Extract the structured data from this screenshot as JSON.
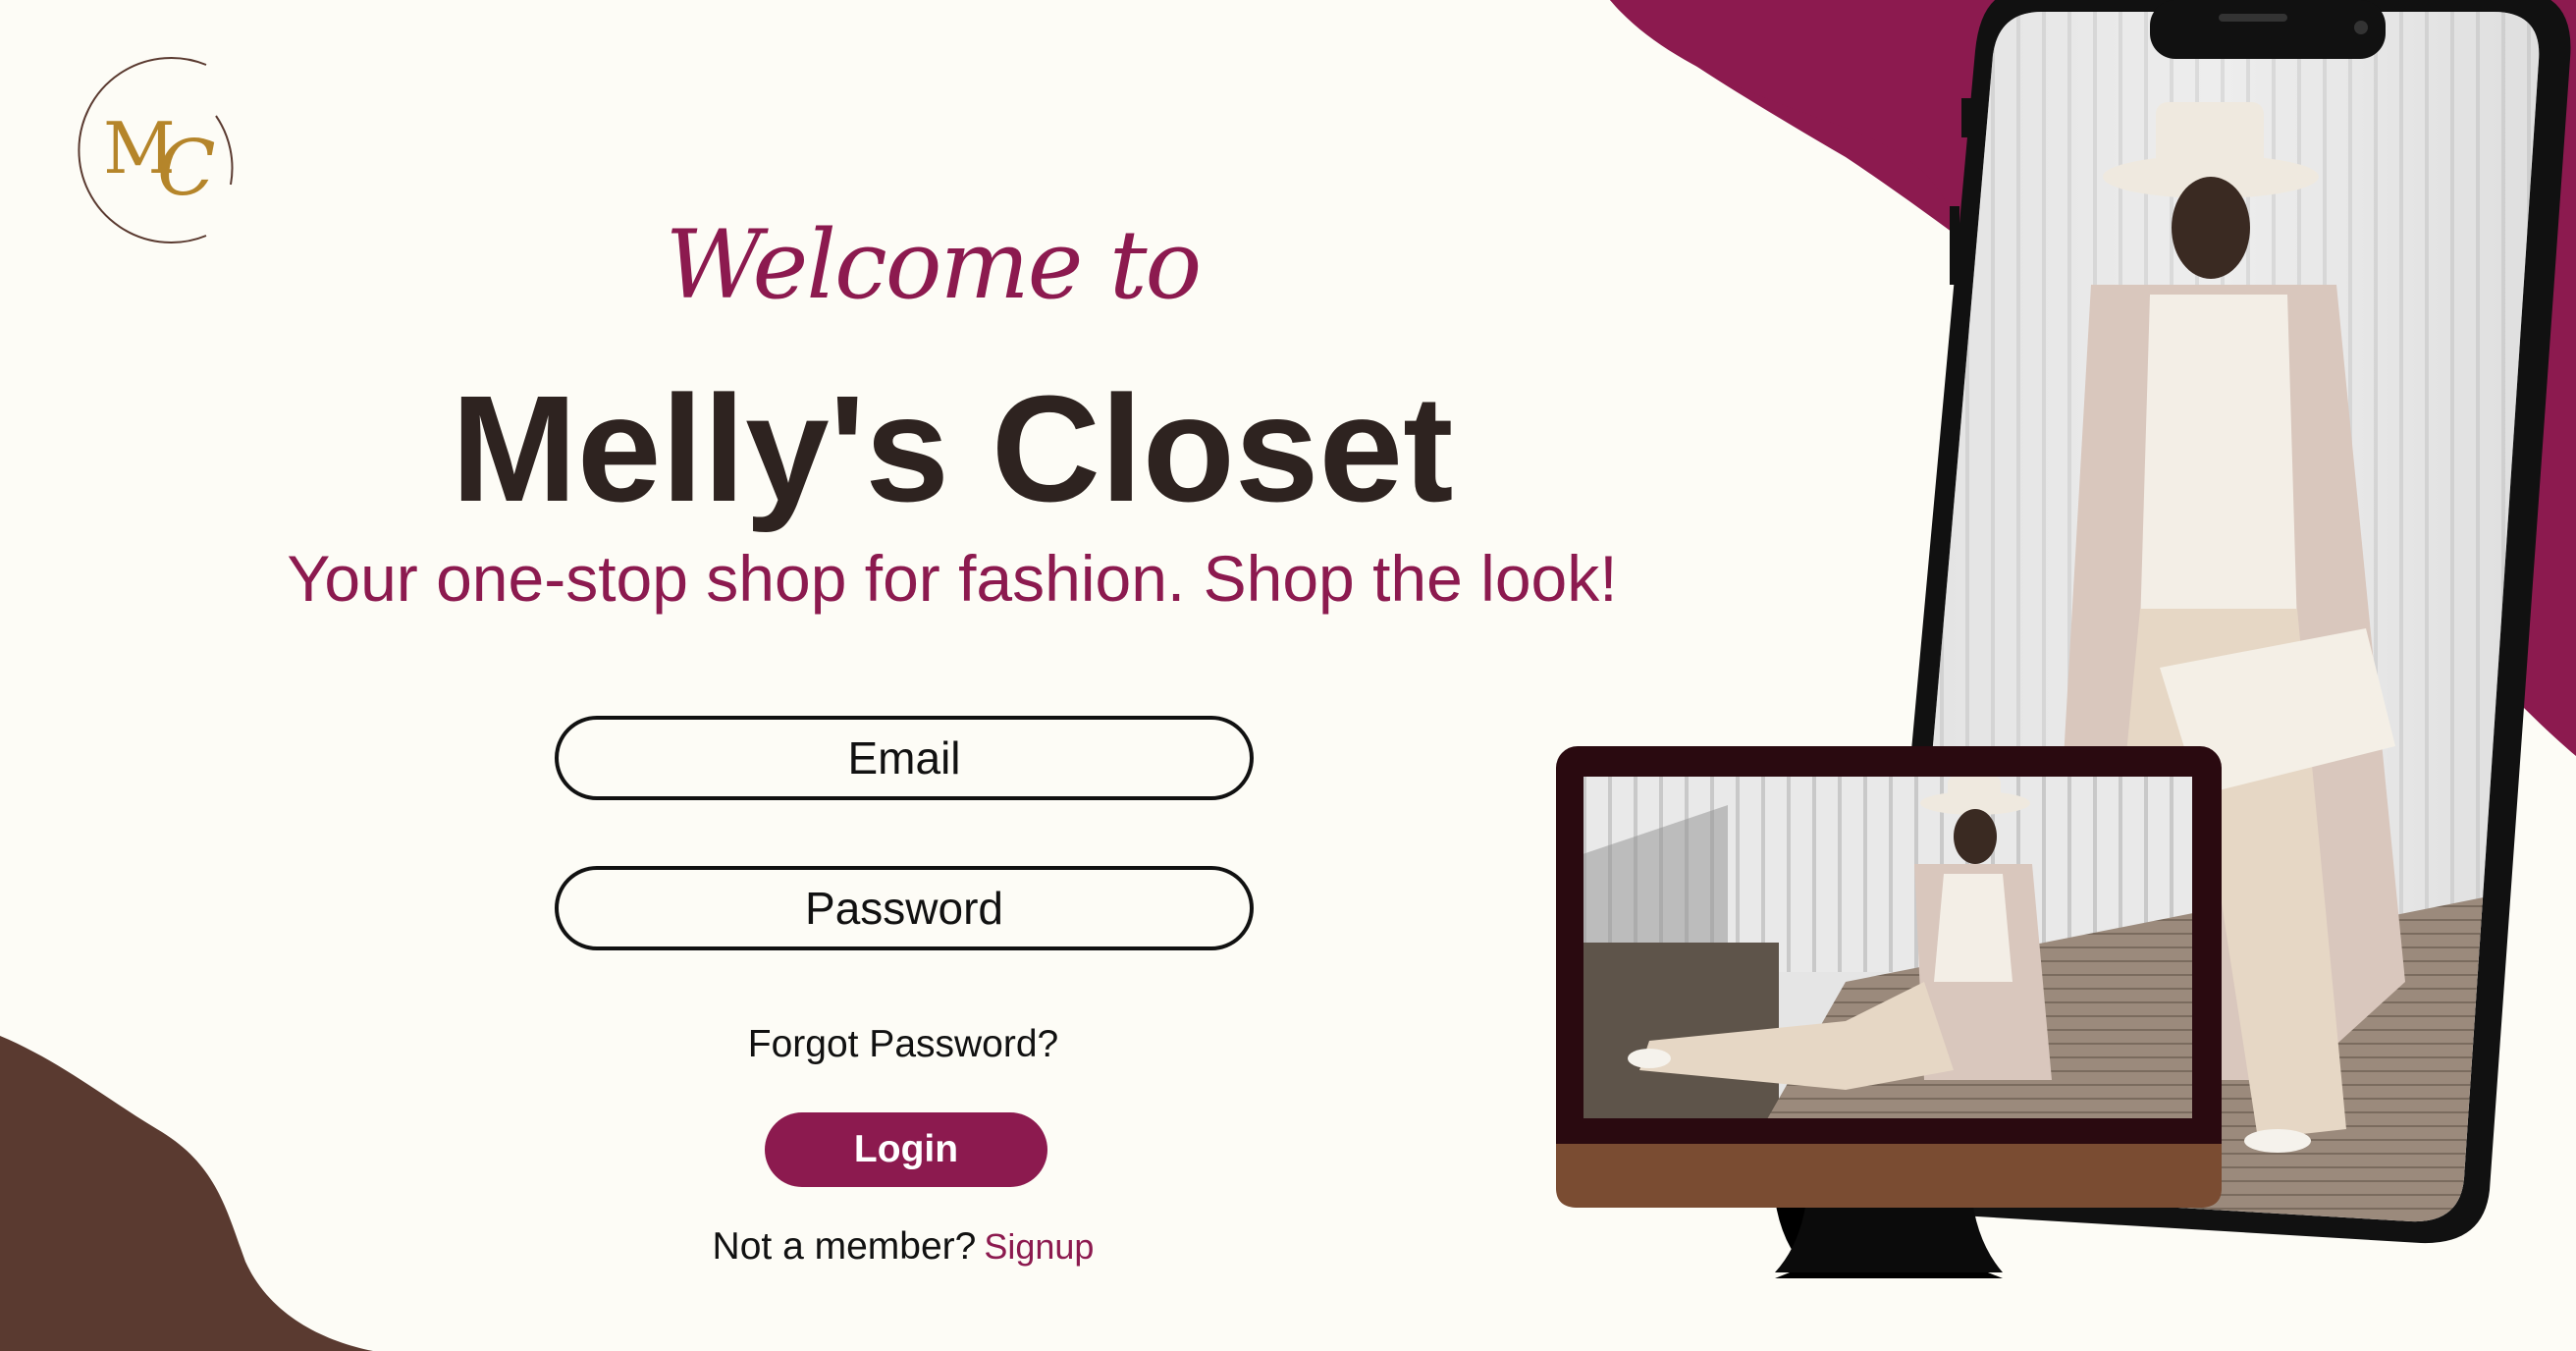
{
  "logo": {
    "monogram": "MC"
  },
  "hero": {
    "welcome": "Welcome to",
    "brand": "Melly's Closet",
    "tagline": "Your one-stop shop for fashion. Shop the look!"
  },
  "form": {
    "email_placeholder": "Email",
    "password_placeholder": "Password",
    "forgot_label": "Forgot Password?",
    "login_label": "Login",
    "member_prompt": "Not a member?",
    "signup_label": "Signup"
  },
  "colors": {
    "background": "#fdfcf6",
    "accent": "#8c1a4f",
    "dark_brown": "#5a3a30",
    "text": "#2e2320",
    "logo_gold": "#b5852a"
  }
}
